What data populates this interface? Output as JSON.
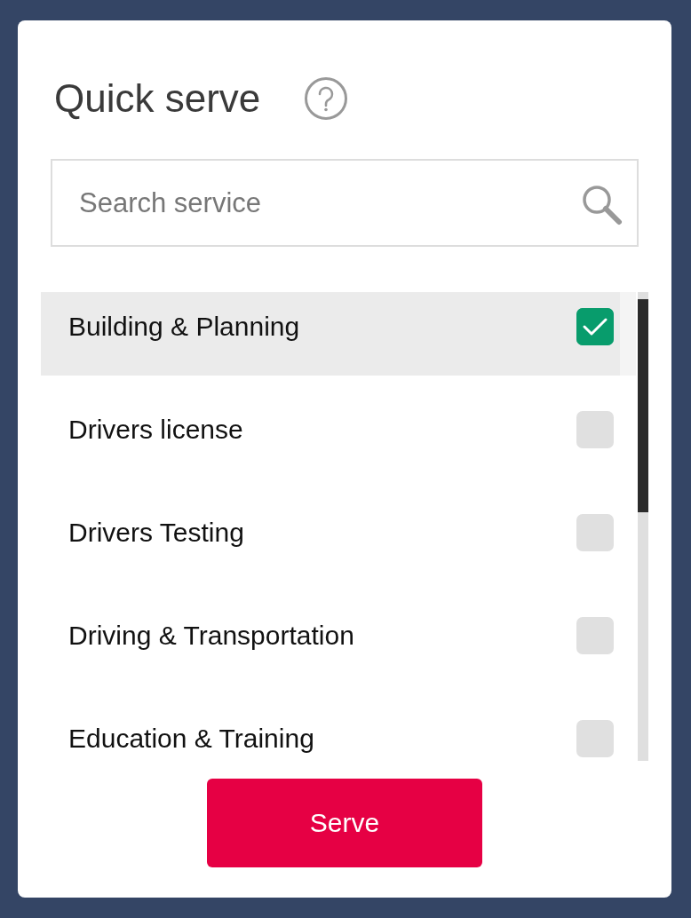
{
  "header": {
    "title": "Quick serve"
  },
  "search": {
    "placeholder": "Search service"
  },
  "services": [
    {
      "label": "Building & Planning",
      "selected": true,
      "checked": true
    },
    {
      "label": "Drivers license",
      "selected": false,
      "checked": false
    },
    {
      "label": "Drivers Testing",
      "selected": false,
      "checked": false
    },
    {
      "label": "Driving & Transportation",
      "selected": false,
      "checked": false
    },
    {
      "label": "Education & Training",
      "selected": false,
      "checked": false
    }
  ],
  "primary_button": {
    "label": "Serve"
  }
}
